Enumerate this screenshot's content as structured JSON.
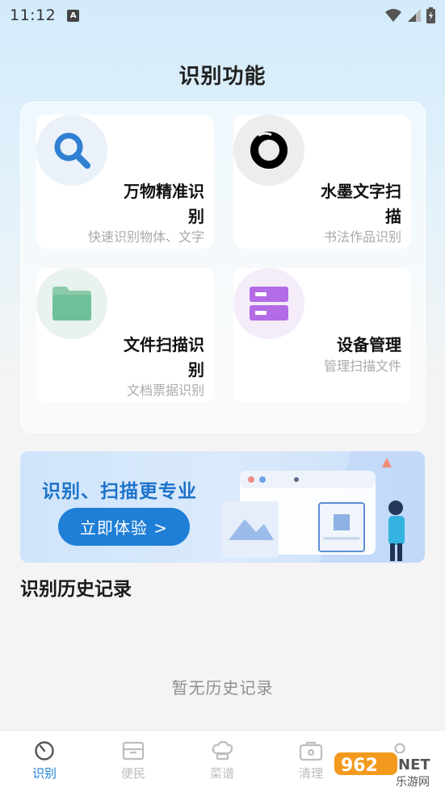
{
  "status_bar": {
    "time": "11:12",
    "notification_letter": "A"
  },
  "page_title": "识别功能",
  "features": [
    {
      "title": "万物精准识别",
      "subtitle": "快速识别物体、文字",
      "icon": "search-icon",
      "icon_bg": "#eaf1f8",
      "color": "#2f7fd2"
    },
    {
      "title": "水墨文字扫描",
      "subtitle": "书法作品识别",
      "icon": "ink-ring-icon",
      "icon_bg": "#ededed",
      "color": "#000000"
    },
    {
      "title": "文件扫描识别",
      "subtitle": "文档票据识别",
      "icon": "folder-icon",
      "icon_bg": "#e8f2ee",
      "color": "#6fbf9a"
    },
    {
      "title": "设备管理",
      "subtitle": "管理扫描文件",
      "icon": "storage-icon",
      "icon_bg": "#f5ecfa",
      "color": "#b36be6"
    }
  ],
  "banner": {
    "headline": "识别、扫描更专业",
    "cta": "立即体验 >"
  },
  "history": {
    "title": "识别历史记录",
    "empty_text": "暂无历史记录"
  },
  "tabs": [
    {
      "label": "识别",
      "icon": "scan-dial-icon",
      "active": true
    },
    {
      "label": "便民",
      "icon": "box-icon",
      "active": false
    },
    {
      "label": "菜谱",
      "icon": "chef-hat-icon",
      "active": false
    },
    {
      "label": "清理",
      "icon": "briefcase-icon",
      "active": false
    }
  ],
  "colors": {
    "accent": "#1f7fd7",
    "inactive_tab": "#bdbdbd"
  },
  "watermark": {
    "brand": "962",
    "suffix": "NET",
    "subtitle": "乐游网"
  }
}
